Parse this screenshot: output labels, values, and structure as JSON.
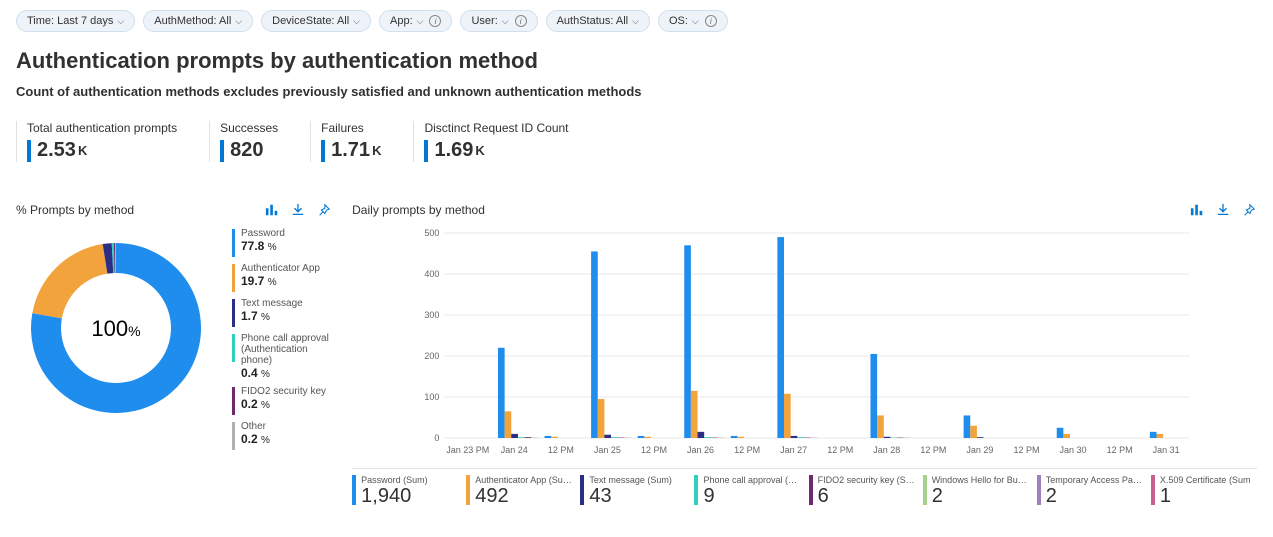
{
  "filters": [
    {
      "label": "Time: Last 7 days",
      "hasInfo": false
    },
    {
      "label": "AuthMethod: All",
      "hasInfo": false
    },
    {
      "label": "DeviceState: All",
      "hasInfo": false
    },
    {
      "label": "App: <unset>",
      "hasInfo": true
    },
    {
      "label": "User: <unset>",
      "hasInfo": true
    },
    {
      "label": "AuthStatus: All",
      "hasInfo": false
    },
    {
      "label": "OS: <unset>",
      "hasInfo": true
    }
  ],
  "title": "Authentication prompts by authentication method",
  "subtitle": "Count of authentication methods excludes previously satisfied and unknown authentication methods",
  "kpis": [
    {
      "label": "Total authentication prompts",
      "value": "2.53",
      "suffix": "K"
    },
    {
      "label": "Successes",
      "value": "820",
      "suffix": ""
    },
    {
      "label": "Failures",
      "value": "1.71",
      "suffix": "K"
    },
    {
      "label": "Disctinct Request ID Count",
      "value": "1.69",
      "suffix": "K"
    }
  ],
  "donut": {
    "title": "% Prompts by method",
    "center_value": "100",
    "center_suffix": "%",
    "items": [
      {
        "name": "Password",
        "pct": 77.8,
        "color": "#1f8ded"
      },
      {
        "name": "Authenticator App",
        "pct": 19.7,
        "color": "#f2a33c"
      },
      {
        "name": "Text message",
        "pct": 1.7,
        "color": "#2b2e84"
      },
      {
        "name": "Phone call approval (Authentication phone)",
        "pct": 0.4,
        "color": "#2ed1c0"
      },
      {
        "name": "FIDO2 security key",
        "pct": 0.2,
        "color": "#6b2b6c"
      },
      {
        "name": "Other",
        "pct": 0.2,
        "color": "#b0b0b0"
      }
    ]
  },
  "bar": {
    "title": "Daily prompts by method",
    "totals": [
      {
        "label": "Password (Sum)",
        "value": "1,940",
        "color": "#1f8ded"
      },
      {
        "label": "Authenticator App (Sum)",
        "value": "492",
        "color": "#f2a33c"
      },
      {
        "label": "Text message (Sum)",
        "value": "43",
        "color": "#2b2e84"
      },
      {
        "label": "Phone call approval (Auth...",
        "value": "9",
        "color": "#2ed1c0"
      },
      {
        "label": "FIDO2 security key (Sum)",
        "value": "6",
        "color": "#6b2b6c"
      },
      {
        "label": "Windows Hello for Busine...",
        "value": "2",
        "color": "#a8d18d"
      },
      {
        "label": "Temporary Access Pass (S...",
        "value": "2",
        "color": "#9e7fbf"
      },
      {
        "label": "X.509 Certificate (Sum",
        "value": "1",
        "color": "#c85f8e"
      }
    ]
  },
  "chart_data": [
    {
      "type": "pie",
      "title": "% Prompts by method",
      "series": [
        {
          "name": "Password",
          "value": 77.8
        },
        {
          "name": "Authenticator App",
          "value": 19.7
        },
        {
          "name": "Text message",
          "value": 1.7
        },
        {
          "name": "Phone call approval (Authentication phone)",
          "value": 0.4
        },
        {
          "name": "FIDO2 security key",
          "value": 0.2
        },
        {
          "name": "Other",
          "value": 0.2
        }
      ]
    },
    {
      "type": "bar",
      "title": "Daily prompts by method",
      "xlabel": "",
      "ylabel": "",
      "ylim": [
        0,
        500
      ],
      "categories": [
        "Jan 23 PM",
        "Jan 24",
        "12 PM",
        "Jan 25",
        "12 PM",
        "Jan 26",
        "12 PM",
        "Jan 27",
        "12 PM",
        "Jan 28",
        "12 PM",
        "Jan 29",
        "12 PM",
        "Jan 30",
        "12 PM",
        "Jan 31"
      ],
      "series": [
        {
          "name": "Password",
          "values": [
            0,
            220,
            5,
            455,
            5,
            470,
            5,
            490,
            0,
            205,
            0,
            55,
            0,
            25,
            0,
            15
          ]
        },
        {
          "name": "Authenticator App",
          "values": [
            0,
            65,
            3,
            95,
            3,
            115,
            3,
            108,
            0,
            55,
            0,
            30,
            0,
            10,
            0,
            10
          ]
        },
        {
          "name": "Text message",
          "values": [
            0,
            10,
            0,
            8,
            0,
            15,
            0,
            5,
            0,
            3,
            0,
            2,
            0,
            0,
            0,
            0
          ]
        },
        {
          "name": "Phone call approval",
          "values": [
            0,
            2,
            0,
            2,
            0,
            2,
            0,
            2,
            0,
            1,
            0,
            0,
            0,
            0,
            0,
            0
          ]
        },
        {
          "name": "FIDO2 security key",
          "values": [
            0,
            2,
            0,
            1,
            0,
            1,
            0,
            1,
            0,
            1,
            0,
            0,
            0,
            0,
            0,
            0
          ]
        },
        {
          "name": "Other",
          "values": [
            0,
            1,
            0,
            1,
            0,
            1,
            0,
            1,
            0,
            1,
            0,
            0,
            0,
            0,
            0,
            0
          ]
        }
      ]
    }
  ]
}
